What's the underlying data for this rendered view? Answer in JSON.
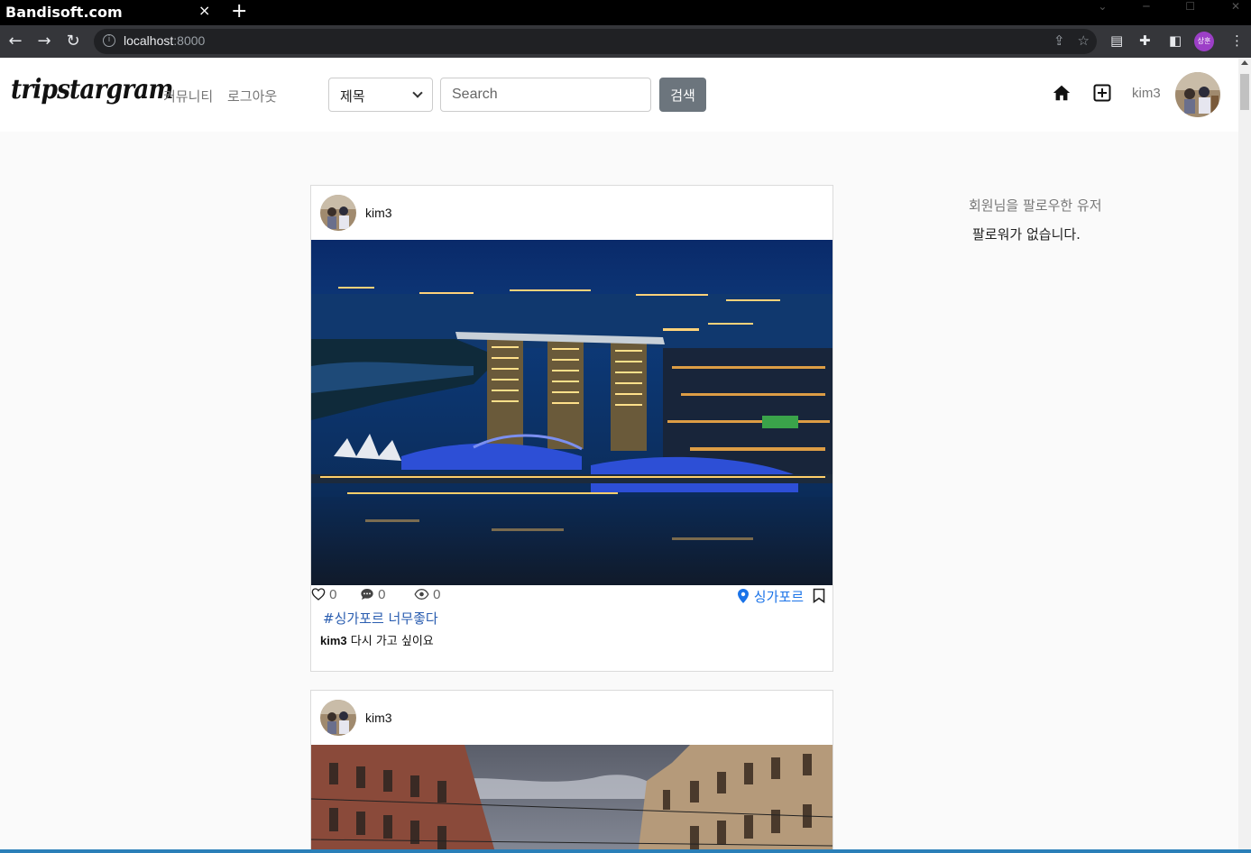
{
  "browser": {
    "tab_title": "Bandisoft.com",
    "tab_close": "×",
    "new_tab": "+",
    "url_host": "localhost",
    "url_port": ":8000",
    "profile_initials": "상훈"
  },
  "navbar": {
    "logo": "tripstargram",
    "links": [
      "커뮤니티",
      "로그아웃"
    ],
    "search_select_value": "제목",
    "search_placeholder": "Search",
    "search_button": "검색",
    "username": "kim3"
  },
  "posts": [
    {
      "author": "kim3",
      "image": "singapore-marina-bay-night",
      "likes": "0",
      "comments": "0",
      "views": "0",
      "location": "싱가포르",
      "tag": "#싱가포르 너무좋다",
      "caption_author": "kim3",
      "caption_text": "다시 가고 싶이요"
    },
    {
      "author": "kim3",
      "image": "european-street-buildings"
    }
  ],
  "sidebar": {
    "title": "회원님을 팔로우한 유저",
    "empty_message": "팔로워가 없습니다."
  },
  "colors": {
    "accent_link": "#1a73e8",
    "tag_blue": "#2a5db0",
    "button_gray": "#6c757d"
  }
}
